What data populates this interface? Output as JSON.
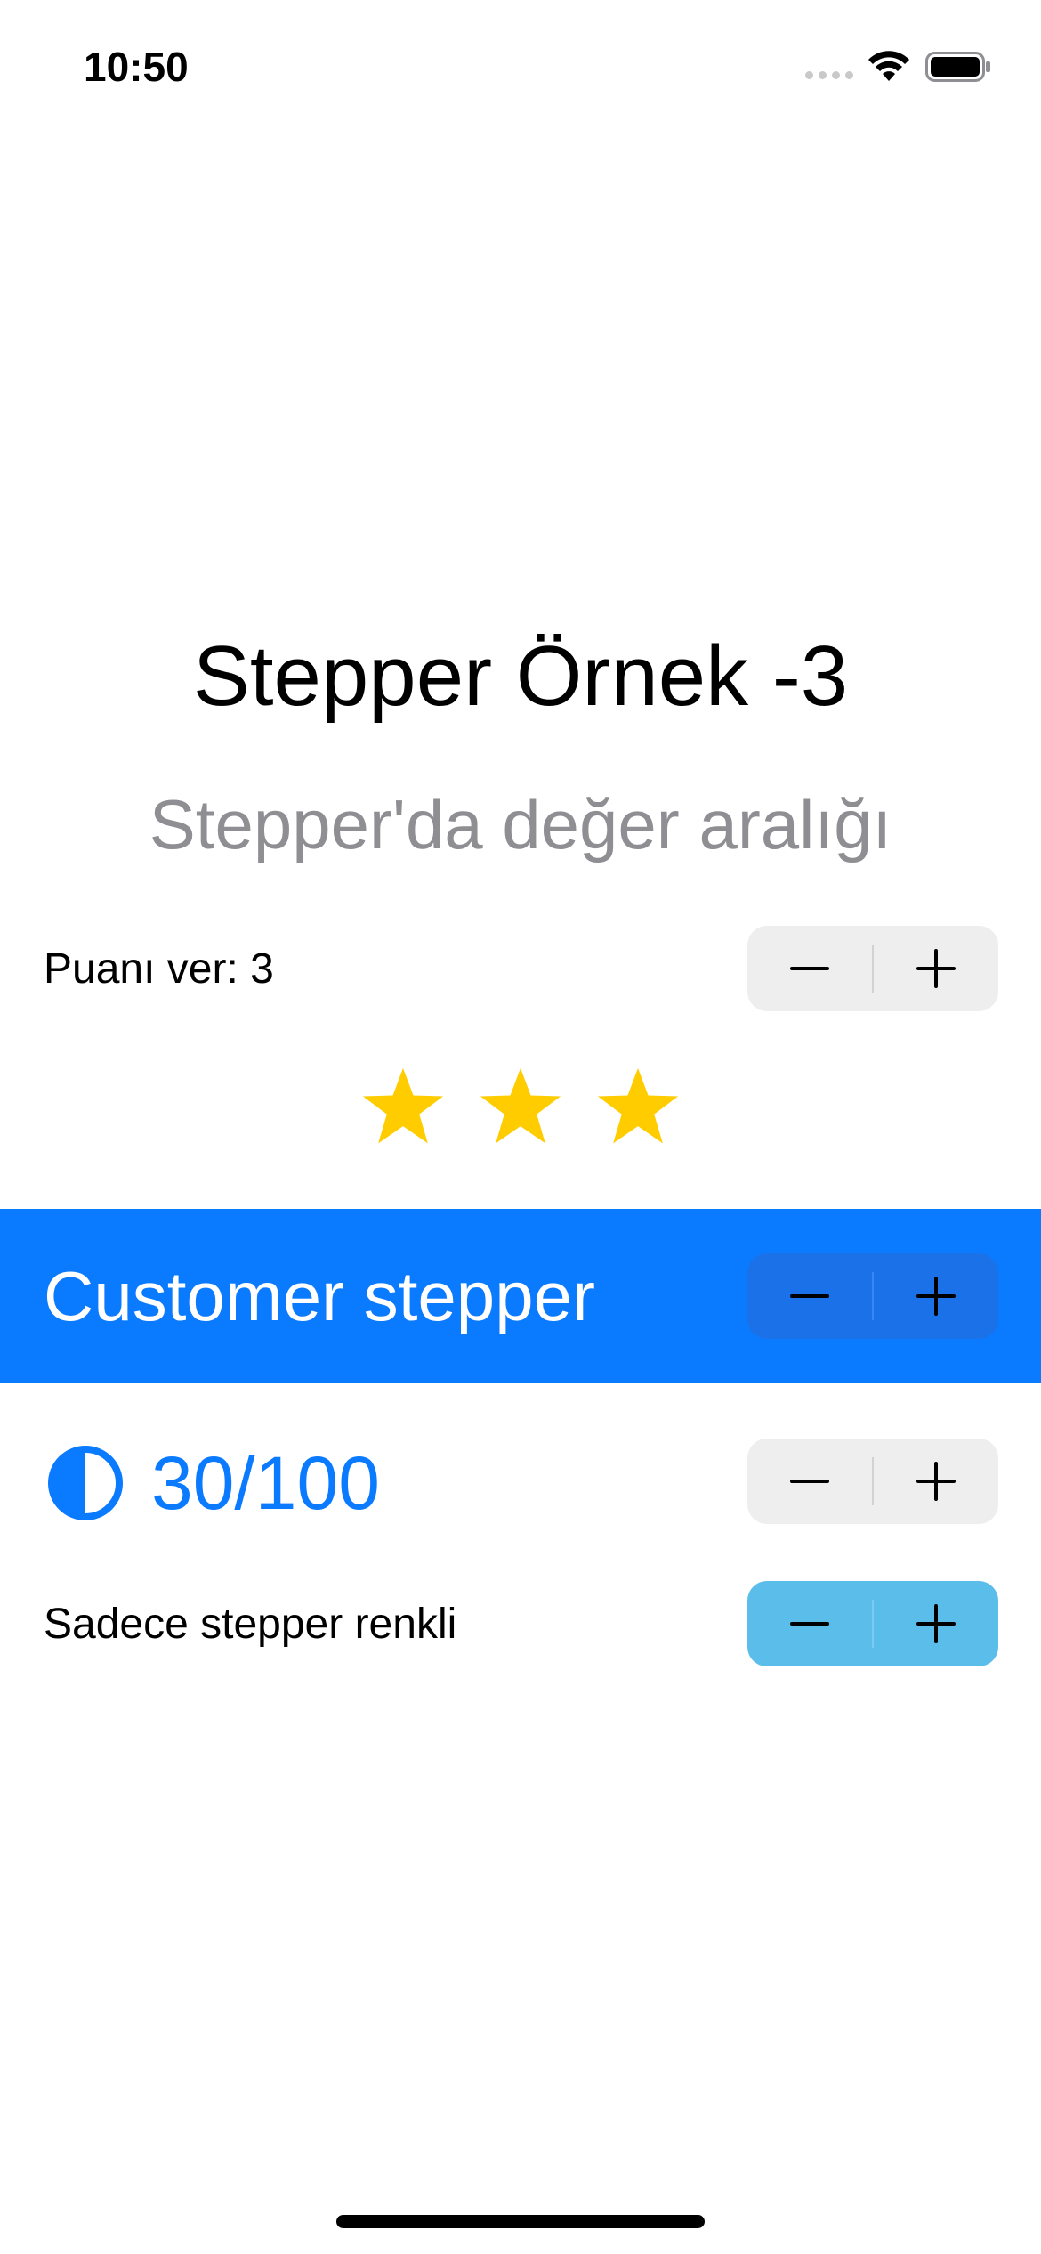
{
  "status_bar": {
    "time": "10:50",
    "icons": [
      "cellular-dots-icon",
      "wifi-icon",
      "battery-icon"
    ]
  },
  "header": {
    "title": "Stepper Örnek -3",
    "subtitle": "Stepper'da değer aralığı"
  },
  "rating": {
    "label": "Puanı ver: 3",
    "value": 3,
    "stars_shown": 3,
    "star_color": "#ffcc00"
  },
  "customer_stepper": {
    "label": "Customer stepper",
    "background_color": "#0a7aff"
  },
  "progress": {
    "icon": "half-circle-icon",
    "text": "30/100",
    "value": 30,
    "max": 100,
    "color": "#0a7aff"
  },
  "colored_stepper": {
    "label": "Sadece stepper renkli",
    "stepper_color": "#5bbdea"
  },
  "stepper_controls": {
    "decrement_icon": "minus-icon",
    "increment_icon": "plus-icon"
  }
}
